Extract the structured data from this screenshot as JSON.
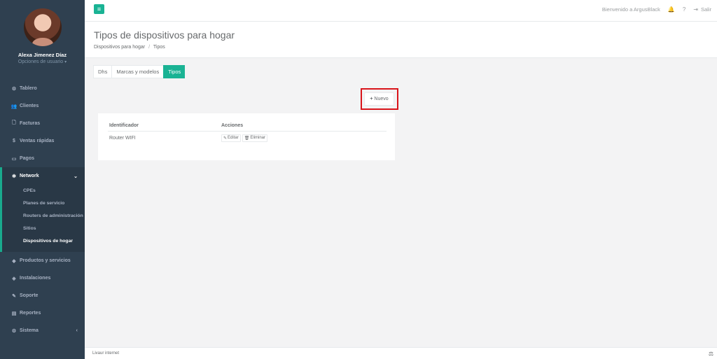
{
  "user": {
    "name": "Alexa Jimenez Díaz",
    "options_label": "Opciones de usuario",
    "options_caret": "▾"
  },
  "sidebar": {
    "items_top": [
      {
        "icon": "⚙",
        "label": "Tablero"
      },
      {
        "icon": "👥",
        "label": "Clientes"
      },
      {
        "icon": "🗋",
        "label": "Facturas"
      },
      {
        "icon": "$",
        "label": "Ventas rápidas"
      },
      {
        "icon": "▭",
        "label": "Pagos"
      }
    ],
    "network": {
      "icon": "✻",
      "label": "Network",
      "arrow": "⌄",
      "subitems": [
        "CPEs",
        "Planes de servicio",
        "Routers de administración",
        "Sitios",
        "Dispositivos de hogar"
      ]
    },
    "items_bottom": [
      {
        "icon": "◆",
        "label": "Productos y servicios"
      },
      {
        "icon": "◈",
        "label": "Instalaciones"
      },
      {
        "icon": "✎",
        "label": "Soporte"
      },
      {
        "icon": "▤",
        "label": "Reportes"
      },
      {
        "icon": "⚙",
        "label": "Sistema",
        "arrow": "‹"
      }
    ]
  },
  "topbar": {
    "menu_icon": "≡",
    "welcome": "Bienvenido a ArgusBlack",
    "bell_icon": "🔔",
    "help_icon": "?",
    "logout_icon": "⇥",
    "logout_label": "Salir"
  },
  "page": {
    "title": "Tipos de dispositivos para hogar",
    "breadcrumb": {
      "parent": "Dispositivos para hogar",
      "sep": "/",
      "current": "Tipos"
    }
  },
  "tabs": [
    {
      "label": "Dhs",
      "active": false
    },
    {
      "label": "Marcas y modelos",
      "active": false
    },
    {
      "label": "Tipos",
      "active": true
    }
  ],
  "actions": {
    "new_plus": "+",
    "new_label": "Nuevo"
  },
  "table": {
    "headers": [
      "Identificador",
      "Acciones"
    ],
    "rows": [
      {
        "identifier": "Router WIFI",
        "edit_label": "Editar",
        "delete_label": "Eliminar"
      }
    ]
  },
  "footer": {
    "text": "Livaur internet",
    "icon": "⚖"
  }
}
